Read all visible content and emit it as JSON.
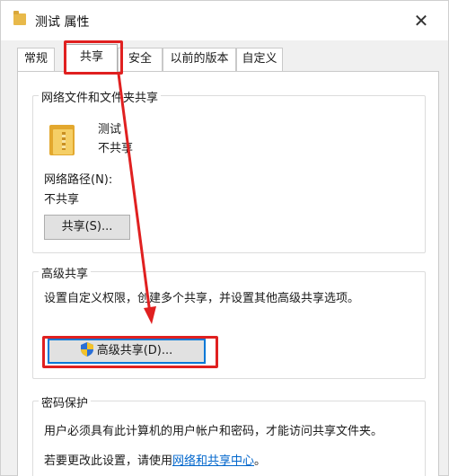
{
  "window": {
    "title": "测试 属性",
    "close_symbol": "✕"
  },
  "tabs": [
    {
      "label": "常规"
    },
    {
      "label": "共享"
    },
    {
      "label": "安全"
    },
    {
      "label": "以前的版本"
    },
    {
      "label": "自定义"
    }
  ],
  "network_share": {
    "group_title": "网络文件和文件夹共享",
    "folder_name": "测试",
    "folder_status": "不共享",
    "path_label": "网络路径(N):",
    "path_value": "不共享",
    "share_button": "共享(S)..."
  },
  "advanced_share": {
    "group_title": "高级共享",
    "description": "设置自定义权限，创建多个共享，并设置其他高级共享选项。",
    "button": "高级共享(D)..."
  },
  "password_protect": {
    "group_title": "密码保护",
    "description": "用户必须具有此计算机的用户帐户和密码，才能访问共享文件夹。",
    "change_text": "若要更改此设置，请使用",
    "change_link": "网络和共享中心",
    "change_suffix": "。"
  },
  "colors": {
    "annotation_red": "#e02020",
    "link_blue": "#0066cc",
    "focus_blue": "#0078d7"
  },
  "icons": [
    "folder-icon",
    "shield-icon",
    "close-icon"
  ]
}
